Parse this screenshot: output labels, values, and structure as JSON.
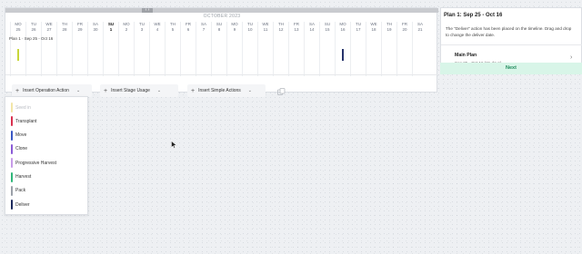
{
  "timeline": {
    "month_label": "OCTOBER 2023",
    "scroll_glyph": "‹ ›",
    "plan_label": "Plan 1 · Sep 25 - Oct 16",
    "days": [
      {
        "dow": "MO",
        "num": "25"
      },
      {
        "dow": "TU",
        "num": "26"
      },
      {
        "dow": "WE",
        "num": "27"
      },
      {
        "dow": "TH",
        "num": "28"
      },
      {
        "dow": "FR",
        "num": "29"
      },
      {
        "dow": "SA",
        "num": "30"
      },
      {
        "dow": "SU",
        "num": "1",
        "bold": true
      },
      {
        "dow": "MO",
        "num": "2"
      },
      {
        "dow": "TU",
        "num": "3"
      },
      {
        "dow": "WE",
        "num": "4"
      },
      {
        "dow": "TH",
        "num": "5"
      },
      {
        "dow": "FR",
        "num": "6"
      },
      {
        "dow": "SA",
        "num": "7"
      },
      {
        "dow": "SU",
        "num": "8"
      },
      {
        "dow": "MO",
        "num": "9"
      },
      {
        "dow": "TU",
        "num": "10"
      },
      {
        "dow": "WE",
        "num": "11"
      },
      {
        "dow": "TH",
        "num": "12"
      },
      {
        "dow": "FR",
        "num": "13"
      },
      {
        "dow": "SA",
        "num": "14"
      },
      {
        "dow": "SU",
        "num": "15"
      },
      {
        "dow": "MO",
        "num": "16"
      },
      {
        "dow": "TU",
        "num": "17"
      },
      {
        "dow": "WE",
        "num": "18"
      },
      {
        "dow": "TH",
        "num": "19"
      },
      {
        "dow": "FR",
        "num": "20"
      },
      {
        "dow": "SA",
        "num": "21"
      }
    ],
    "markers": [
      {
        "name": "seed-in-marker",
        "day_index": 0,
        "color": "#c8d63a"
      },
      {
        "name": "deliver-marker",
        "day_index": 21,
        "color": "#26336b"
      }
    ]
  },
  "toolbar": {
    "insert_operation": "Insert Operation Action",
    "insert_stage": "Insert Stage Usage",
    "insert_simple": "Insert Simple Actions",
    "plus_glyph": "+",
    "caret_glyph": "⌄"
  },
  "operation_menu": {
    "items": [
      {
        "label": "Seed in",
        "color": "#f2e6a8",
        "disabled": true
      },
      {
        "label": "Transplant",
        "color": "#d9304f",
        "disabled": false
      },
      {
        "label": "Move",
        "color": "#3a57c4",
        "disabled": false
      },
      {
        "label": "Clone",
        "color": "#8a5ad6",
        "disabled": false
      },
      {
        "label": "Progressive Harvest",
        "color": "#c79be8",
        "disabled": false
      },
      {
        "label": "Harvest",
        "color": "#2fb67a",
        "disabled": false
      },
      {
        "label": "Pack",
        "color": "#9aa0a8",
        "disabled": false
      },
      {
        "label": "Deliver",
        "color": "#1d2a5c",
        "disabled": false
      }
    ]
  },
  "panel": {
    "title": "Plan 1: Sep 25 - Oct 16",
    "message": "The \"Deliver\" action has been placed on the timeline. Drag and drop to change the deliver date.",
    "plan_name": "Main Plan",
    "plan_dates": "Sep 25 - Oct 16 (21 days)",
    "chevron_glyph": "›",
    "next_label": "Next"
  },
  "colors": {
    "next_bg": "#d8f5e8",
    "next_text": "#1f8a5b"
  }
}
